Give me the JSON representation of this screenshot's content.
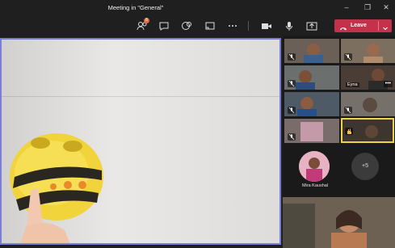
{
  "window": {
    "title": "Meeting in \"General\"",
    "minimize": "–",
    "maximize": "❐",
    "close": "✕"
  },
  "toolbar": {
    "participants_badge": "8",
    "more": "•••",
    "leave_label": "Leave",
    "leave_color": "#c4314b"
  },
  "icons": [
    "people-icon",
    "chat-icon",
    "reactions-icon",
    "share-tray-icon",
    "more-icon",
    "camera-icon",
    "mic-icon",
    "share-icon",
    "phone-hangup-icon",
    "chevron-down-icon"
  ],
  "participants": {
    "tiles": [
      {
        "name": ""
      },
      {
        "name": ""
      },
      {
        "name": ""
      },
      {
        "name": "Eyna"
      },
      {
        "name": ""
      },
      {
        "name": ""
      },
      {
        "name": ""
      },
      {
        "name": ""
      }
    ],
    "avatar_name": "Mira Kaushal",
    "overflow": "+5"
  },
  "accent": "#7a7fd6",
  "speaking_border": "#f0d24a"
}
